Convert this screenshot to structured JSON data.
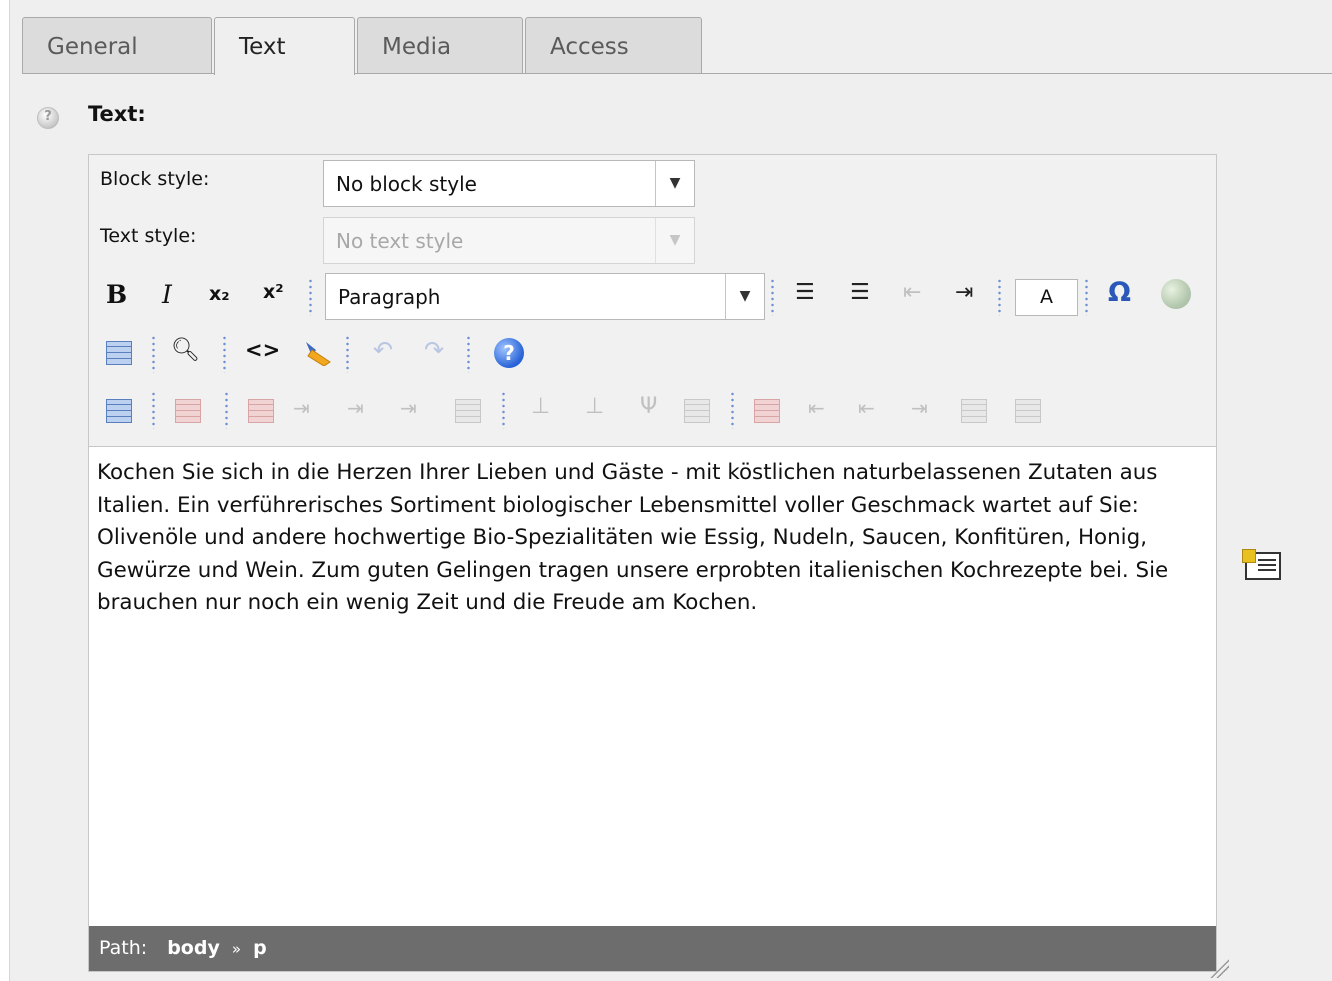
{
  "tabs": [
    {
      "label": "General"
    },
    {
      "label": "Text"
    },
    {
      "label": "Media"
    },
    {
      "label": "Access"
    }
  ],
  "field": {
    "label": "Text:"
  },
  "editor": {
    "block_style_label": "Block style:",
    "block_style_value": "No block style",
    "text_style_label": "Text style:",
    "text_style_value": "No text style",
    "format_value": "Paragraph",
    "font_size_value": "A",
    "bold_glyph": "B",
    "italic_glyph": "I",
    "subscript_glyph": "x₂",
    "superscript_glyph": "x²",
    "omega_glyph": "Ω",
    "source_glyph": "<>",
    "undo_glyph": "↶",
    "redo_glyph": "↷",
    "help_glyph": "?",
    "content": "Kochen Sie sich in die Herzen Ihrer Lieben und Gäste - mit köstlichen naturbelassenen Zutaten aus Italien. Ein verführerisches Sortiment biologischer Lebensmittel voller Geschmack wartet auf Sie: Olivenöle und andere hochwertige Bio-Spezialitäten wie Essig, Nudeln, Saucen, Konfitüren, Honig, Gewürze und Wein. Zum guten Gelingen tragen unsere erprobten italienischen Kochrezepte bei. Sie brauchen nur noch ein wenig Zeit und die Freude am Kochen.",
    "path_label": "Path:",
    "path_body": "body",
    "path_sep": "»",
    "path_p": "p"
  },
  "icons": {
    "help": "help-circle-icon",
    "wizard": "rte-wizard-icon"
  }
}
